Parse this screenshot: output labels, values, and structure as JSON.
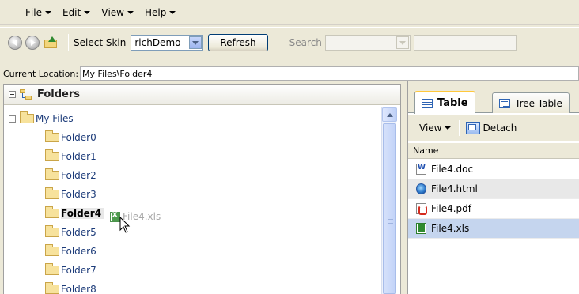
{
  "menubar": {
    "items": [
      {
        "acc": "F",
        "rest": "ile"
      },
      {
        "acc": "E",
        "rest": "dit"
      },
      {
        "acc": "V",
        "rest": "iew"
      },
      {
        "acc": "H",
        "rest": "elp"
      }
    ]
  },
  "toolbar": {
    "select_skin_label": "Select Skin",
    "skin_value": "richDemo",
    "refresh_label": "Refresh",
    "search_label": "Search"
  },
  "location": {
    "label": "Current Location:",
    "value": "My Files\\Folder4"
  },
  "left_panel": {
    "title": "Folders",
    "root_label": "My Files",
    "folders": [
      "Folder0",
      "Folder1",
      "Folder2",
      "Folder3",
      "Folder4",
      "Folder5",
      "Folder6",
      "Folder7",
      "Folder8"
    ],
    "selected_folder": "Folder4",
    "drag_ghost_label": "File4.xls"
  },
  "right_panel": {
    "tabs": [
      "Table",
      "Tree Table"
    ],
    "active_tab": "Table",
    "view_label": "View",
    "detach_label": "Detach",
    "column_header": "Name",
    "files": [
      {
        "name": "File4.doc",
        "icon": "word-doc-icon"
      },
      {
        "name": "File4.html",
        "icon": "html-globe-icon"
      },
      {
        "name": "File4.pdf",
        "icon": "pdf-icon"
      },
      {
        "name": "File4.xls",
        "icon": "excel-icon"
      }
    ],
    "selected_file": "File4.xls"
  },
  "colors": {
    "menu_bg": "#ece9d8",
    "tree_text": "#1d3c7a",
    "selection": "#c5d5ee",
    "alt_row": "#e8e8e8",
    "tab_accent": "#ffc83c"
  }
}
